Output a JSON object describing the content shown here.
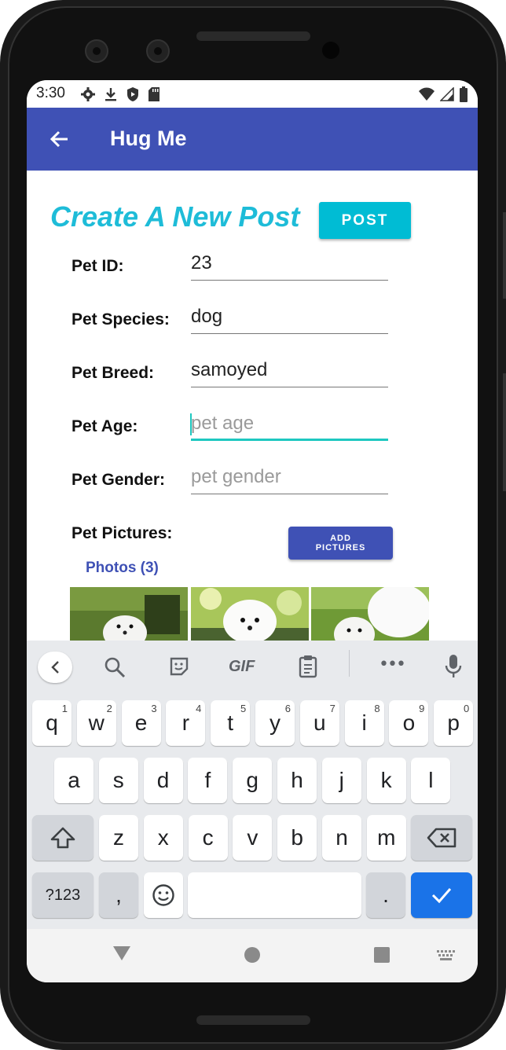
{
  "status_bar": {
    "time": "3:30"
  },
  "app_bar": {
    "title": "Hug Me"
  },
  "form": {
    "heading": "Create A New Post",
    "post_label": "POST",
    "fields": [
      {
        "label": "Pet ID:",
        "value": "23",
        "placeholder": ""
      },
      {
        "label": "Pet Species:",
        "value": "dog",
        "placeholder": ""
      },
      {
        "label": "Pet Breed:",
        "value": "samoyed",
        "placeholder": ""
      },
      {
        "label": "Pet Age:",
        "value": "",
        "placeholder": "pet age"
      },
      {
        "label": "Pet Gender:",
        "value": "",
        "placeholder": "pet gender"
      }
    ],
    "pictures_label": "Pet Pictures:",
    "add_pictures_line1": "ADD",
    "add_pictures_line2": "PICTURES",
    "photos_label": "Photos (3)"
  },
  "keyboard": {
    "toolbar": {
      "gif": "GIF",
      "more": "•••"
    },
    "row1": [
      {
        "k": "q",
        "s": "1"
      },
      {
        "k": "w",
        "s": "2"
      },
      {
        "k": "e",
        "s": "3"
      },
      {
        "k": "r",
        "s": "4"
      },
      {
        "k": "t",
        "s": "5"
      },
      {
        "k": "y",
        "s": "6"
      },
      {
        "k": "u",
        "s": "7"
      },
      {
        "k": "i",
        "s": "8"
      },
      {
        "k": "o",
        "s": "9"
      },
      {
        "k": "p",
        "s": "0"
      }
    ],
    "row2": [
      "a",
      "s",
      "d",
      "f",
      "g",
      "h",
      "j",
      "k",
      "l"
    ],
    "row3": [
      "z",
      "x",
      "c",
      "v",
      "b",
      "n",
      "m"
    ],
    "sym_label": "?123",
    "comma": ",",
    "period": "."
  },
  "colors": {
    "primary": "#3f51b5",
    "accent": "#00bcd4",
    "heading": "#1ebcd8",
    "focus": "#1ec8c0"
  }
}
